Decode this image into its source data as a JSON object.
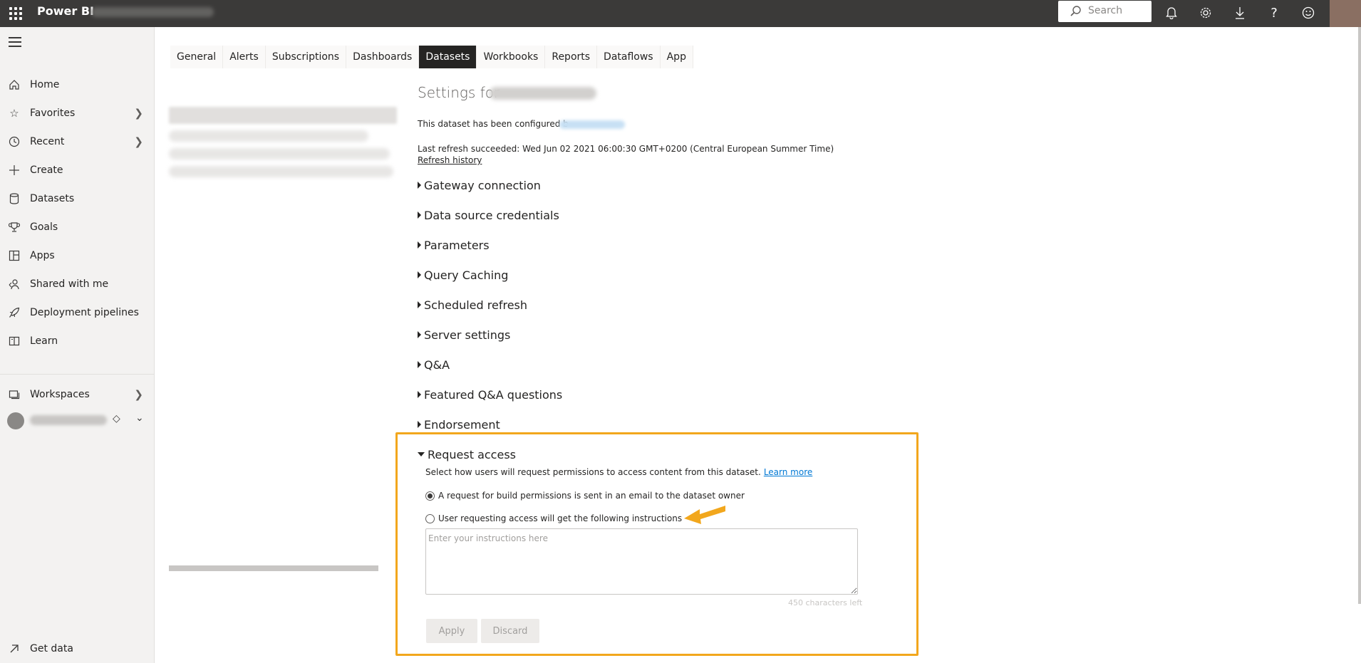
{
  "topbar": {
    "brand": "Power BI",
    "search_placeholder": "Search",
    "icons": [
      "waffle-icon",
      "bell-icon",
      "gear-icon",
      "download-icon",
      "help-icon",
      "smiley-icon"
    ]
  },
  "nav": {
    "items": [
      {
        "label": "Home",
        "icon": "home-icon"
      },
      {
        "label": "Favorites",
        "icon": "star-icon"
      },
      {
        "label": "Recent",
        "icon": "clock-icon"
      },
      {
        "label": "Create",
        "icon": "plus-icon"
      },
      {
        "label": "Datasets",
        "icon": "database-icon"
      },
      {
        "label": "Goals",
        "icon": "trophy-icon"
      },
      {
        "label": "Apps",
        "icon": "apps-icon"
      },
      {
        "label": "Shared with me",
        "icon": "shared-icon"
      },
      {
        "label": "Deployment pipelines",
        "icon": "rocket-icon"
      },
      {
        "label": "Learn",
        "icon": "book-icon"
      }
    ],
    "workspaces": "Workspaces",
    "get_data": "Get data"
  },
  "tabs": [
    "General",
    "Alerts",
    "Subscriptions",
    "Dashboards",
    "Datasets",
    "Workbooks",
    "Reports",
    "Dataflows",
    "App"
  ],
  "active_tab": "Datasets",
  "settings": {
    "title": "Settings for",
    "configured": "This dataset has been configured b",
    "last_refresh": "Last refresh succeeded: Wed Jun 02 2021 06:00:30 GMT+0200 (Central European Summer Time)",
    "refresh_history": "Refresh history",
    "sections": [
      "Gateway connection",
      "Data source credentials",
      "Parameters",
      "Query Caching",
      "Scheduled refresh",
      "Server settings",
      "Q&A",
      "Featured Q&A questions",
      "Endorsement"
    ],
    "request_access": {
      "title": "Request access",
      "description": "Select how users will request permissions to access content from this dataset.",
      "learn_more": "Learn more",
      "option_1": "A request for build permissions is sent in an email to the dataset owner",
      "option_2": "User requesting access will get the following instructions",
      "placeholder": "Enter your instructions here",
      "chars_left": "450 characters left",
      "apply": "Apply",
      "discard": "Discard"
    }
  },
  "colors": {
    "topbar": "#3b3a39",
    "highlight": "#f2a71d",
    "link": "#0078d4"
  }
}
